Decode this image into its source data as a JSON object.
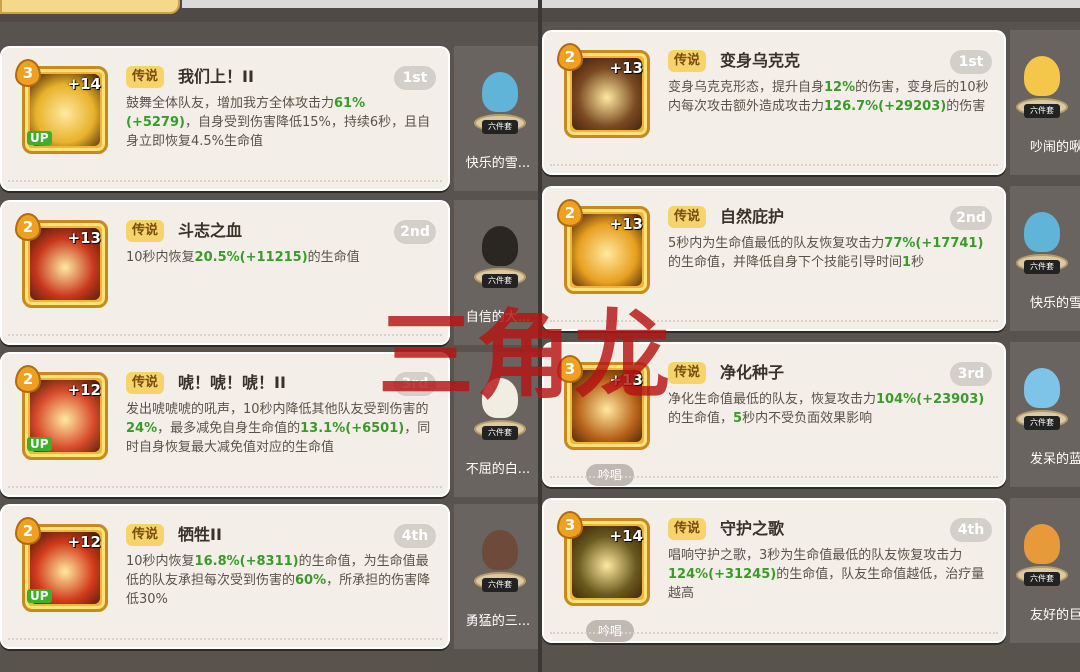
{
  "left": {
    "cards": [
      {
        "level": "3",
        "plus": "+14",
        "up": "UP",
        "chant": "",
        "tag": "传说",
        "name": "我们上！II",
        "rank": "1st",
        "desc_parts": [
          [
            "鼓舞全体队友，增加我方全体攻击力",
            ""
          ],
          [
            "61%",
            "g"
          ],
          [
            "(+52\n79)",
            "g"
          ],
          [
            "，自身受到伤害降低15%，持续6秒，且自身立即恢复4.5%生命值",
            ""
          ]
        ],
        "side": {
          "name": "快乐的雪...",
          "set": "六件套"
        },
        "colors": {
          "icon_bg": "#e8b22a",
          "figure": "#5fb4d8"
        }
      },
      {
        "level": "2",
        "plus": "+13",
        "up": "",
        "chant": "",
        "tag": "传说",
        "name": "斗志之血",
        "rank": "2nd",
        "desc_parts": [
          [
            "10秒内恢复",
            ""
          ],
          [
            "20.5%",
            "g"
          ],
          [
            "(+11215)",
            "g"
          ],
          [
            "的生命值",
            ""
          ]
        ],
        "side": {
          "name": "自信的大...",
          "set": "六件套"
        },
        "colors": {
          "icon_bg": "#c8361c",
          "figure": "#2a2622"
        }
      },
      {
        "level": "2",
        "plus": "+12",
        "up": "UP",
        "chant": "",
        "tag": "传说",
        "name": "唬！唬！唬！II",
        "rank": "3rd",
        "desc_parts": [
          [
            "发出唬唬唬的吼声，10秒内降低其他队友受到伤害的",
            ""
          ],
          [
            "24%",
            "g"
          ],
          [
            "，最多减免自身生命值的",
            ""
          ],
          [
            "13.1%",
            "g"
          ],
          [
            "(+6501)",
            "g"
          ],
          [
            "，同时自身恢复最大减免值对应的生命值",
            ""
          ]
        ],
        "side": {
          "name": "不屈的白...",
          "set": "六件套"
        },
        "colors": {
          "icon_bg": "#d84a2a",
          "figure": "#f2ede2"
        }
      },
      {
        "level": "2",
        "plus": "+12",
        "up": "UP",
        "chant": "",
        "tag": "传说",
        "name": "牺牲II",
        "rank": "4th",
        "desc_parts": [
          [
            "10秒内恢复",
            ""
          ],
          [
            "16.8%",
            "g"
          ],
          [
            "(+8311)",
            "g"
          ],
          [
            "的生命值，为生命值最低的队友承担每次受到伤害的",
            ""
          ],
          [
            "60%",
            "g"
          ],
          [
            "，所承担的伤害降低30%",
            ""
          ]
        ],
        "side": {
          "name": "勇猛的三...",
          "set": "六件套"
        },
        "colors": {
          "icon_bg": "#d23a1a",
          "figure": "#6e4a3a"
        }
      }
    ]
  },
  "right": {
    "cards": [
      {
        "level": "2",
        "plus": "+13",
        "up": "",
        "chant": "",
        "tag": "传说",
        "name": "变身乌克克",
        "rank": "1st",
        "desc_parts": [
          [
            "变身乌克克形态，提升自身",
            ""
          ],
          [
            "12%",
            "g"
          ],
          [
            "的伤害，变身后的10秒内每次攻击额外造成攻击力",
            ""
          ],
          [
            "126.7%",
            "g"
          ],
          [
            "(+29203)",
            "g"
          ],
          [
            "的伤害",
            ""
          ]
        ],
        "side": {
          "name": "吵闹的啾...",
          "set": "六件套"
        },
        "colors": {
          "icon_bg": "#7a4a22",
          "figure": "#f4c64a"
        }
      },
      {
        "level": "2",
        "plus": "+13",
        "up": "",
        "chant": "",
        "tag": "传说",
        "name": "自然庇护",
        "rank": "2nd",
        "desc_parts": [
          [
            "5秒内为生命值最低的队友恢复攻击力",
            ""
          ],
          [
            "77%",
            "g"
          ],
          [
            "(+17741)",
            "g"
          ],
          [
            "的生命值，并降低自身下个技能引导时间",
            ""
          ],
          [
            "1",
            "g"
          ],
          [
            "秒",
            ""
          ]
        ],
        "side": {
          "name": "快乐的雪...",
          "set": "六件套"
        },
        "colors": {
          "icon_bg": "#e8a020",
          "figure": "#5fb4d8"
        }
      },
      {
        "level": "3",
        "plus": "+13",
        "up": "",
        "chant": "吟唱",
        "tag": "传说",
        "name": "净化种子",
        "rank": "3rd",
        "desc_parts": [
          [
            "净化生命值最低的队友，恢复攻击力",
            ""
          ],
          [
            "104%",
            "g"
          ],
          [
            "(+23903)",
            "g"
          ],
          [
            "的生命值，",
            ""
          ],
          [
            "5",
            "g"
          ],
          [
            "秒内不受负面效果影响",
            ""
          ]
        ],
        "side": {
          "name": "发呆的蓝...",
          "set": "六件套"
        },
        "colors": {
          "icon_bg": "#b8641a",
          "figure": "#7ec4e8"
        }
      },
      {
        "level": "3",
        "plus": "+14",
        "up": "",
        "chant": "吟唱",
        "tag": "传说",
        "name": "守护之歌",
        "rank": "4th",
        "desc_parts": [
          [
            "唱响守护之歌，3秒为生命值最低的队友恢复攻击力",
            ""
          ],
          [
            "124%",
            "g"
          ],
          [
            "(+31245)",
            "g"
          ],
          [
            "的生命值，队友生命值越低，治疗量越高",
            ""
          ]
        ],
        "side": {
          "name": "友好的巨...",
          "set": "六件套"
        },
        "colors": {
          "icon_bg": "#6a5a1e",
          "figure": "#e89a3a"
        }
      }
    ]
  },
  "stamp_text": "三角龙"
}
